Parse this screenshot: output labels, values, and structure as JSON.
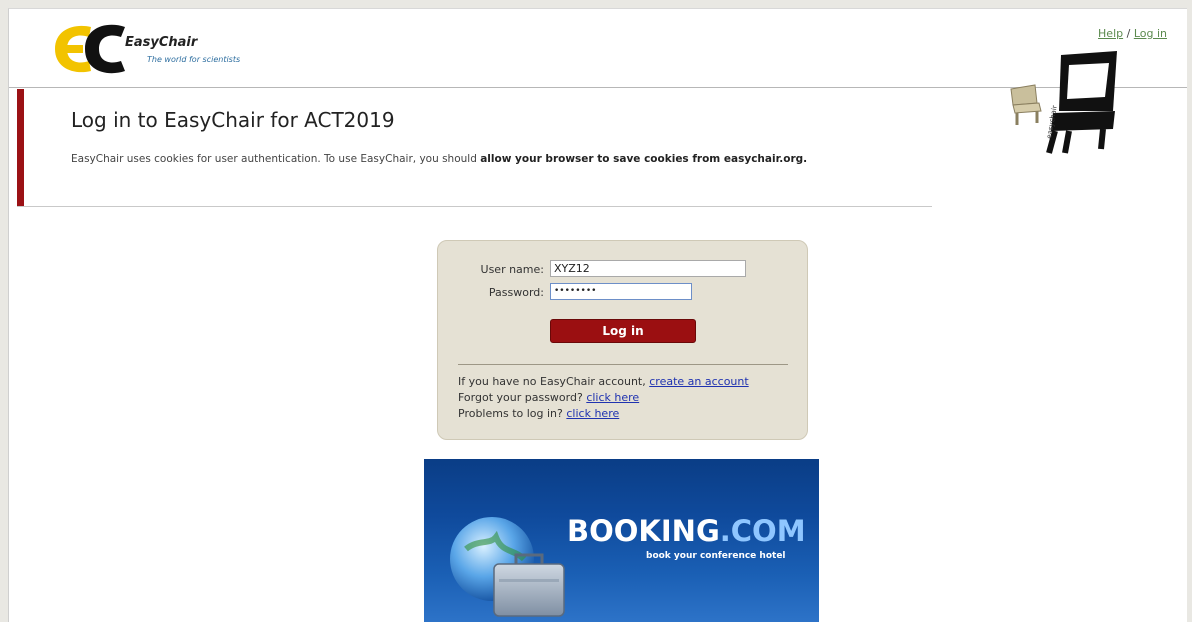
{
  "header": {
    "logo_name": "EasyChair",
    "logo_tagline": "The world for scientists",
    "help_link": "Help",
    "separator": "/",
    "login_link": "Log in"
  },
  "main": {
    "title": "Log in to EasyChair for ACT2019",
    "cookie_text": "EasyChair uses cookies for user authentication. To use EasyChair, you should ",
    "cookie_bold": "allow your browser to save cookies from easychair.org."
  },
  "login": {
    "username_label": "User name:",
    "username_value": "XYZ12",
    "password_label": "Password:",
    "password_value": "••••••••",
    "login_button": "Log in",
    "no_account_text": "If you have no EasyChair account, ",
    "create_account_link": "create an account",
    "forgot_text": "Forgot your password? ",
    "forgot_link": "click here",
    "problems_text": "Problems to log in? ",
    "problems_link": "click here"
  },
  "banner": {
    "brand_main": "BOOKING",
    "brand_dot_com": ".COM",
    "tagline": "book your conference hotel"
  },
  "colors": {
    "accent_red": "#9b1115",
    "login_box_bg": "#e5e1d4",
    "link_blue": "#1f32b0",
    "banner_blue": "#0f4a9c"
  }
}
